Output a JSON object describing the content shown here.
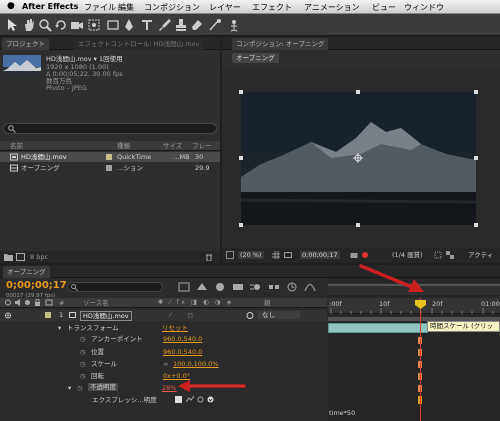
{
  "menubar": {
    "app_name": "After Effects",
    "items": [
      "ファイル",
      "編集",
      "コンポジション",
      "レイヤー",
      "エフェクト",
      "アニメーション",
      "ビュー",
      "ウィンドウ"
    ]
  },
  "project_panel": {
    "tab_label": "プロジェクト",
    "effects_tab_label": "エフェクトコントロール: HD浅間山.mov",
    "asset": {
      "name": "HD浅間山.mov ▾ 1回使用",
      "size": "1920 x 1080 (1.00)",
      "duration": "Δ 0;00;05;22, 30.00 fps",
      "colors": "数百万色",
      "codec": "Photo – JPEG"
    },
    "search_placeholder": "",
    "columns": [
      "名前",
      "種類",
      "サイズ",
      "フレー"
    ],
    "rows": [
      {
        "name": "HD浅間山.mov",
        "type": "QuickTime",
        "size": "…MB",
        "fps": "30"
      },
      {
        "name": "オープニング",
        "type": "…ション",
        "size": "",
        "fps": "29.9"
      }
    ],
    "bpc_label": "8 bpc"
  },
  "comp_panel": {
    "tab_label": "コンポジション: オープニング",
    "subtab_label": "オープニング",
    "zoom": "(20 %)",
    "timecode": "0;00;00;17",
    "resolution": "(1/4 画質)",
    "view_label": "アクティ"
  },
  "timeline": {
    "tab_label": "オープニング",
    "timecode": "0;00;00;17",
    "frame_info": "00017 (29.97 fps)",
    "search_placeholder": "",
    "source_header": "ソース名",
    "parent_header": "親",
    "ruler": [
      ":00f",
      "10f",
      "20f",
      "01:00f"
    ],
    "layer": {
      "index": "1",
      "name": "HD浅間山.mov",
      "parent": "なし"
    },
    "transform_label": "トランスフォーム",
    "reset_label": "リセット",
    "properties": [
      {
        "name": "アンカーポイント",
        "value": "960.0,540.0"
      },
      {
        "name": "位置",
        "value": "960.0,540.0"
      },
      {
        "name": "スケール",
        "value": "100.0,100.0%"
      },
      {
        "name": "回転",
        "value": "0x+0.0°"
      }
    ],
    "opacity_label": "不透明度",
    "opacity_value": "28%",
    "expression_label": "エクスプレッシ…明度",
    "expression_text": "time*50",
    "tooltip": "時間スケール (クリッ"
  },
  "colors": {
    "accent": "#e89a1e",
    "playhead": "#d94030",
    "annotation_arrow": "#cc1f1f",
    "layer_bar": "#8fc7c0"
  }
}
